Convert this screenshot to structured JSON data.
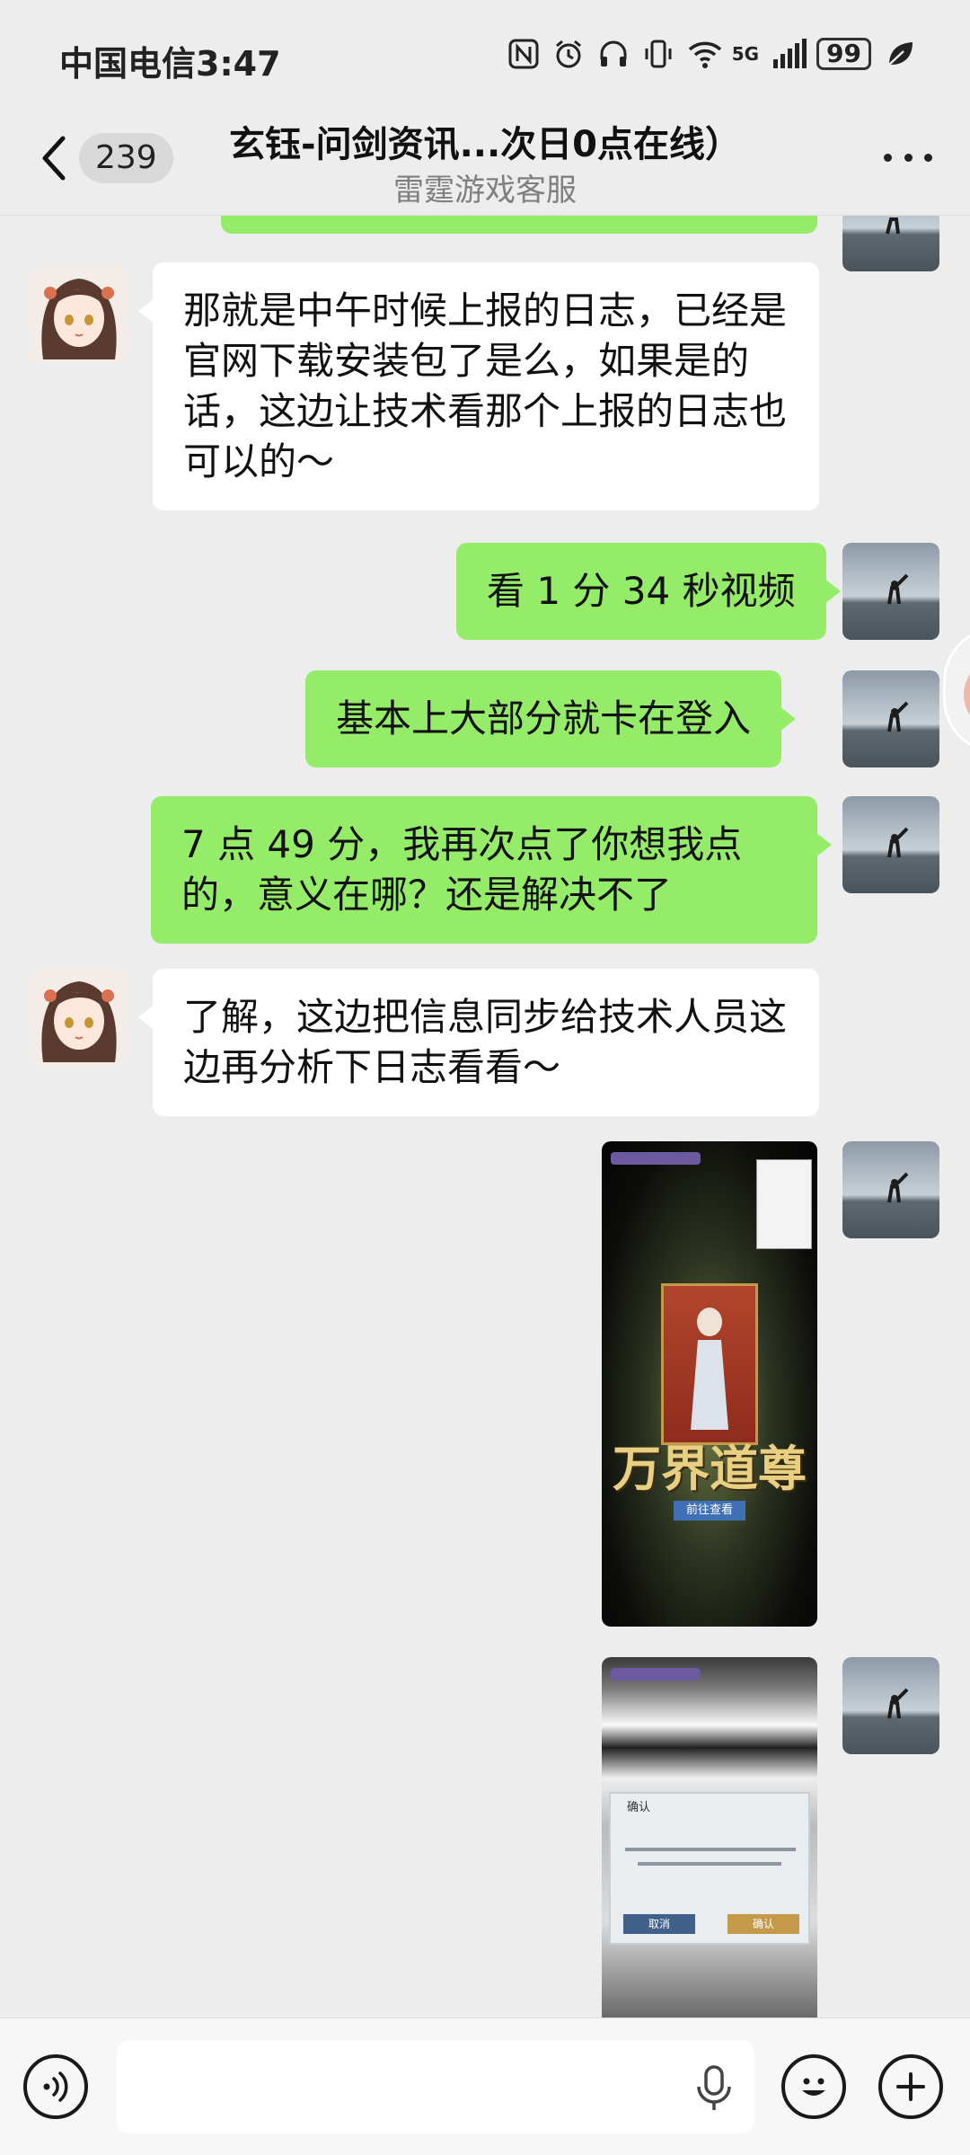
{
  "status_bar": {
    "carrier": "中国电信",
    "time": "3:47",
    "network": "5G",
    "battery": "99",
    "icons": [
      "nfc-icon",
      "alarm-icon",
      "headphones-icon",
      "vibrate-icon",
      "wifi-icon",
      "signal-icon",
      "battery-icon",
      "leaf-icon"
    ]
  },
  "header": {
    "unread_count": "239",
    "title": "玄钰-问剑资讯...次日0点在线）",
    "subtitle": "雷霆游戏客服"
  },
  "messages": [
    {
      "side": "in",
      "type": "text",
      "text": "那就是中午时候上报的日志，已经是官网下载安装包了是么，如果是的话，这边让技术看那个上报的日志也可以的～"
    },
    {
      "side": "out",
      "type": "text",
      "text": "看 1 分 34 秒视频"
    },
    {
      "side": "out",
      "type": "text",
      "text": "基本上大部分就卡在登入"
    },
    {
      "side": "out",
      "type": "text",
      "text": "7 点 49 分，我再次点了你想我点的，意义在哪？还是解决不了"
    },
    {
      "side": "in",
      "type": "text",
      "text": "了解，这边把信息同步给技术人员这边再分析下日志看看～"
    },
    {
      "side": "out",
      "type": "image",
      "image_text": "万界道尊",
      "button_text": "前往查看"
    },
    {
      "side": "out",
      "type": "image",
      "dialog_title": "确认",
      "cancel_text": "取消",
      "confirm_text": "确认"
    }
  ],
  "input_bar": {
    "placeholder": "",
    "icons": [
      "voice-icon",
      "mic-icon",
      "emoji-icon",
      "plus-icon"
    ]
  },
  "colors": {
    "background": "#ededed",
    "outgoing_bubble": "#95ec69",
    "incoming_bubble": "#ffffff"
  }
}
